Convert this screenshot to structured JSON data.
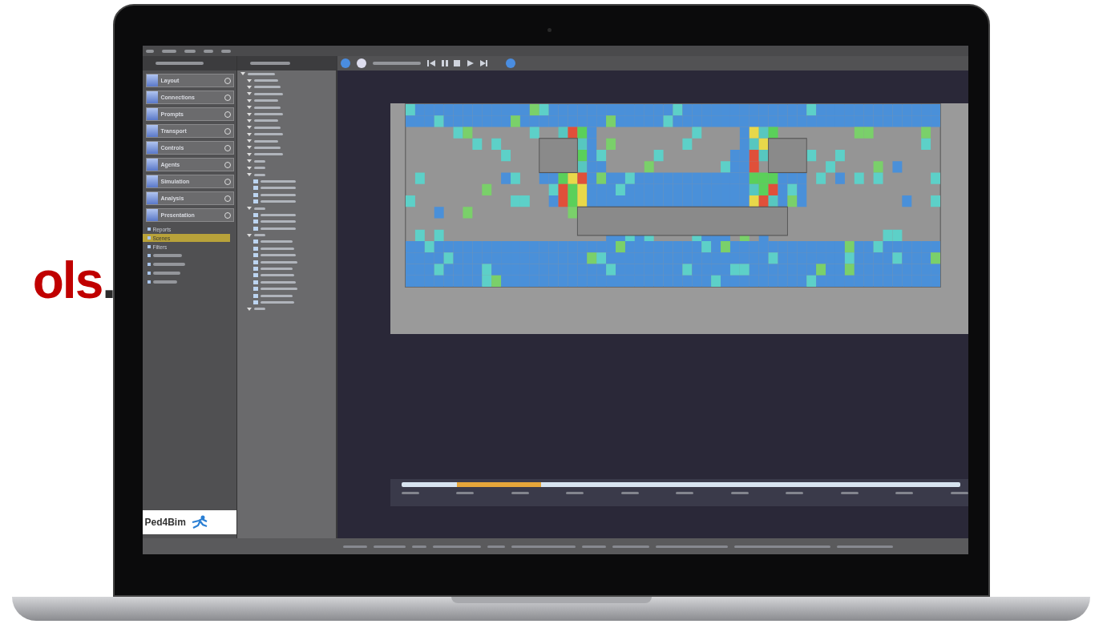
{
  "headline": {
    "letters": "ols",
    "period": "."
  },
  "sidebar": {
    "sections": [
      {
        "label": "Layout",
        "selected": false
      },
      {
        "label": "Connections",
        "selected": false
      },
      {
        "label": "Prompts",
        "selected": false
      },
      {
        "label": "Transport",
        "selected": false
      },
      {
        "label": "Controls",
        "selected": false
      },
      {
        "label": "Agents",
        "selected": false
      },
      {
        "label": "Simulation",
        "selected": false
      },
      {
        "label": "Analysis",
        "selected": false
      },
      {
        "label": "Presentation",
        "selected": false
      }
    ],
    "items": [
      {
        "label": "Reports",
        "selected": false
      },
      {
        "label": "Scenes",
        "selected": true
      },
      {
        "label": "Filters",
        "selected": false
      }
    ],
    "logo": "Ped4Bim"
  }
}
